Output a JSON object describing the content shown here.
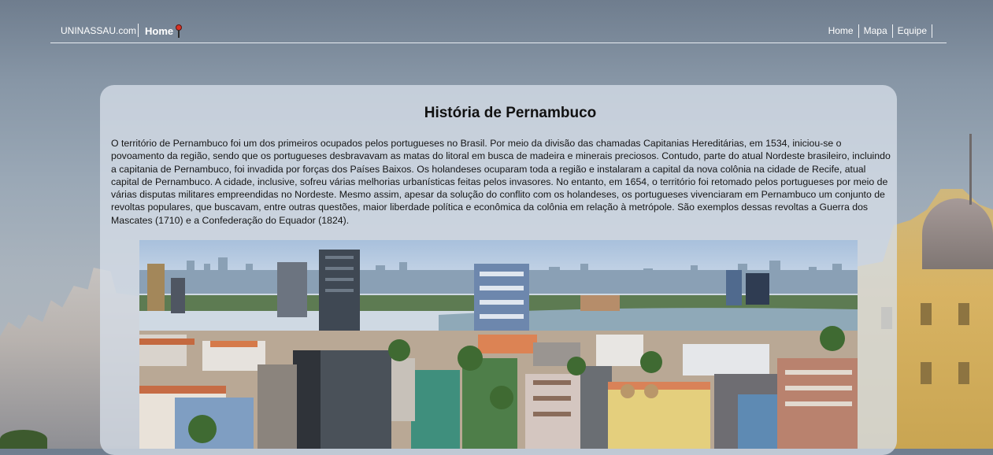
{
  "nav": {
    "brand": "UNINASSAU.com",
    "home_logo": "Home",
    "links": [
      "Home",
      "Mapa",
      "Equipe"
    ]
  },
  "article": {
    "title": "História de Pernambuco",
    "paragraph": "O território de Pernambuco foi um dos primeiros ocupados pelos portugueses no Brasil. Por meio da divisão das chamadas Capitanias Hereditárias, em 1534, iniciou-se o povoamento da região, sendo que os portugueses desbravavam as matas do litoral em busca de madeira e minerais preciosos. Contudo, parte do atual Nordeste brasileiro, incluindo a capitania de Pernambuco, foi invadida por forças dos Países Baixos. Os holandeses ocuparam toda a região e instalaram a capital da nova colônia na cidade de Recife, atual capital de Pernambuco. A cidade, inclusive, sofreu várias melhorias urbanísticas feitas pelos invasores. No entanto, em 1654, o território foi retomado pelos portugueses por meio de várias disputas militares empreendidas no Nordeste. Mesmo assim, apesar da solução do conflito com os holandeses, os portugueses vivenciaram em Pernambuco um conjunto de revoltas populares, que buscavam, entre outras questões, maior liberdade política e econômica da colônia em relação à metrópole. São exemplos dessas revoltas a Guerra dos Mascates (1710) e a Confederação do Equador (1824)."
  },
  "icons": {
    "home_pin": "map-pin-icon"
  },
  "colors": {
    "pin": "#d93225",
    "card": "#d6dee8",
    "river": "#8fa9b8"
  }
}
